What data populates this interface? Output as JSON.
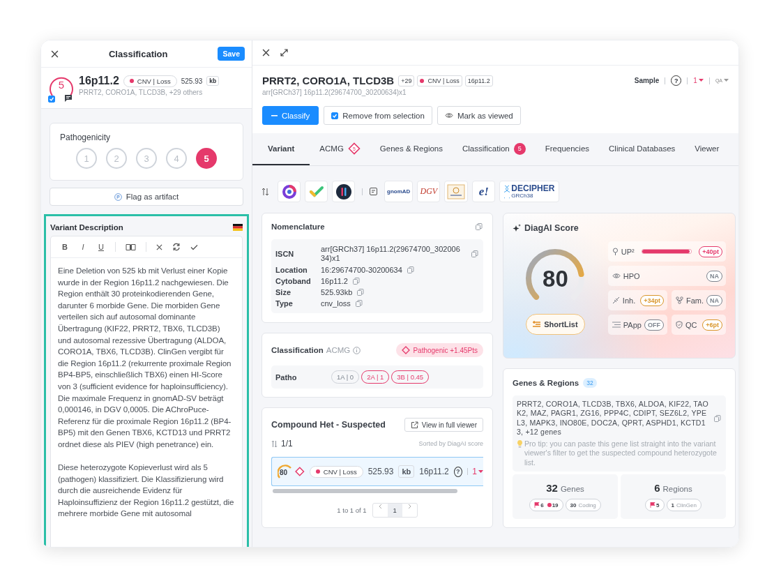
{
  "classification_panel": {
    "title": "Classification",
    "save_button": "Save",
    "variant": {
      "score": "5",
      "reviewed": true,
      "name": "16p11.2",
      "type": "CNV | Loss",
      "size": "525.93",
      "unit": "kb",
      "genes": "PRRT2, CORO1A, TLCD3B, +29 others"
    },
    "pathogenicity": {
      "title": "Pathogenicity",
      "levels": [
        {
          "label": "1",
          "selected": false
        },
        {
          "label": "2",
          "selected": false
        },
        {
          "label": "3",
          "selected": false
        },
        {
          "label": "4",
          "selected": false
        },
        {
          "label": "5",
          "selected": true
        }
      ]
    },
    "flag_button": "Flag as artifact",
    "description": {
      "title": "Variant Description",
      "format_buttons": [
        {
          "label": "B",
          "kind": "bold"
        },
        {
          "label": "I",
          "kind": "italic"
        },
        {
          "label": "U",
          "kind": "underline"
        }
      ],
      "paragraphs": [
        "Eine Deletion von 525 kb mit Verlust einer Kopie wurde in der Region 16p11.2 nachgewiesen. Die Region enthält 30 proteinkodierenden Gene, darunter 6 morbide Gene. Die morbiden Gene verteilen sich auf autosomal dominante Übertragung (KIF22, PRRT2, TBX6, TLCD3B) und autosomal rezessive Übertragung (ALDOA, CORO1A, TBX6, TLCD3B). ClinGen vergibt für die Region 16p11.2 (rekurrente proximale Region BP4-BP5, einschließlich TBX6) einen HI-Score von 3 (sufficient evidence for haploinsufficiency). Die maximale Frequenz in gnomAD-SV beträgt 0,000146, in DGV 0,0005. Die AChroPuce-Referenz für die proximale Region 16p11.2 (BP4-BP5) mit den Genen TBX6, KCTD13 und PRRT2 ordnet diese als PIEV (high penetrance) ein.",
        "Diese heterozygote Kopieverlust wird als 5 (pathogen) klassifiziert. Die Klassifizierung wird durch die ausreichende Evidenz für Haploinsuffizienz der Region 16p11.2 gestützt, die mehrere morbide Gene mit autosomal"
      ]
    }
  },
  "variant_panel": {
    "title": "PRRT2, CORO1A, TLCD3B",
    "badges": [
      {
        "kind": "plain",
        "text": "+29"
      },
      {
        "kind": "dot",
        "text": "CNV | Loss"
      },
      {
        "kind": "plain",
        "text": "16p11.2"
      }
    ],
    "iscn": "arr[GRCh37] 16p11.2(29674700_30200634)x1",
    "toolbar": {
      "sample": "Sample",
      "help": "?",
      "count": "1",
      "qa": "QA"
    },
    "actions": [
      {
        "kind": "primary",
        "label": "Classify"
      },
      {
        "kind": "checkbox",
        "label": "Remove from selection",
        "checked": true
      },
      {
        "kind": "eye",
        "label": "Mark as viewed"
      }
    ],
    "tabs": [
      {
        "label": "Variant",
        "selected": true
      },
      {
        "label": "ACMG",
        "selected": false,
        "badge": {
          "kind": "diamond",
          "text": "5"
        }
      },
      {
        "label": "Genes & Regions",
        "selected": false
      },
      {
        "label": "Classification",
        "selected": false,
        "badge": {
          "kind": "circle",
          "text": "5"
        }
      },
      {
        "label": "Frequencies",
        "selected": false
      },
      {
        "label": "Clinical Databases",
        "selected": false
      },
      {
        "label": "Viewer",
        "selected": false
      }
    ],
    "database_links": [
      {
        "kind": "ring"
      },
      {
        "kind": "check"
      },
      {
        "kind": "dark"
      },
      {
        "kind": "separator"
      },
      {
        "kind": "note"
      },
      {
        "kind": "gnomad",
        "label": "gnomAD"
      },
      {
        "kind": "dgv",
        "label": "DGV"
      },
      {
        "kind": "emblem"
      },
      {
        "kind": "ensembl",
        "label": "e!"
      },
      {
        "kind": "decipher",
        "label": "DECIPHER",
        "sub": "GRCh38"
      }
    ],
    "nomenclature": {
      "title": "Nomenclature",
      "rows": [
        {
          "label": "ISCN",
          "value": "arr[GRCh37] 16p11.2(29674700_30200634)x1"
        },
        {
          "label": "Location",
          "value": "16:29674700-30200634"
        },
        {
          "label": "Cytoband",
          "value": "16p11.2"
        },
        {
          "label": "Size",
          "value": "525.93kb"
        },
        {
          "label": "Type",
          "value": "cnv_loss"
        }
      ]
    },
    "acmg": {
      "title": "Classification",
      "subtitle": "ACMG",
      "verdict": "Pathogenic +1.45Pts",
      "row_label": "Patho",
      "criteria": [
        {
          "label": "1A | 0",
          "met": false
        },
        {
          "label": "2A | 1",
          "met": true
        },
        {
          "label": "3B | 0.45",
          "met": true
        }
      ]
    },
    "compound_het": {
      "title": "Compound Het - Suspected",
      "viewer_button": "View in full viewer",
      "count": "1/1",
      "sort_note": "Sorted by DiagAI score",
      "row": {
        "score": "80",
        "type": "CNV | Loss",
        "size": "525.93",
        "unit": "kb",
        "name": "16p11.2",
        "help": "?",
        "count": "1"
      },
      "range": "1 to 1 of 1",
      "pages": [
        {
          "label": "1",
          "selected": true
        }
      ]
    },
    "diagai": {
      "title": "DiagAI Score",
      "score": "80",
      "shortlist": "ShortList",
      "factors": [
        {
          "kind": "bar",
          "label": "UP²",
          "level": 0.97,
          "value": "+40pt",
          "color": "#e5396b",
          "wide": true
        },
        {
          "kind": "eye",
          "label": "HPO",
          "value": "NA",
          "color": "#7d848e",
          "wide": true
        },
        {
          "kind": "inh",
          "label": "Inh.",
          "value": "+34pt",
          "color": "#d9962b",
          "wide": false
        },
        {
          "kind": "fam",
          "label": "Fam.",
          "value": "NA",
          "color": "#7d848e",
          "wide": false
        },
        {
          "kind": "papp",
          "label": "PApp",
          "value": "OFF",
          "color": "#7d848e",
          "wide": false
        },
        {
          "kind": "qc",
          "label": "QC",
          "value": "+6pt",
          "color": "#d9962b",
          "wide": false
        }
      ]
    },
    "genes_regions": {
      "title": "Genes & Regions",
      "count": "32",
      "gene_list": "PRRT2, CORO1A, TLCD3B, TBX6, ALDOA, KIF22, TAOK2, MAZ, PAGR1, ZG16, PPP4C, CDIPT, SEZ6L2, YPEL3, MAPK3, INO80E, DOC2A, QPRT, ASPHD1, KCTD13, +12 genes",
      "tip": "Pro tip: you can paste this gene list straight into the variant viewer's filter to get the suspected compound heterozygote list.",
      "stats": [
        {
          "number": "32",
          "label": "Genes",
          "pills": [
            [
              {
                "kind": "flag",
                "text": "6"
              },
              {
                "kind": "dot",
                "text": "19"
              }
            ],
            [
              {
                "kind": "count",
                "number": "30",
                "text": "Coding"
              }
            ]
          ]
        },
        {
          "number": "6",
          "label": "Regions",
          "pills": [
            [
              {
                "kind": "flag",
                "text": "5"
              }
            ],
            [
              {
                "kind": "count",
                "number": "1",
                "text": "ClinGen"
              }
            ]
          ]
        }
      ]
    }
  }
}
